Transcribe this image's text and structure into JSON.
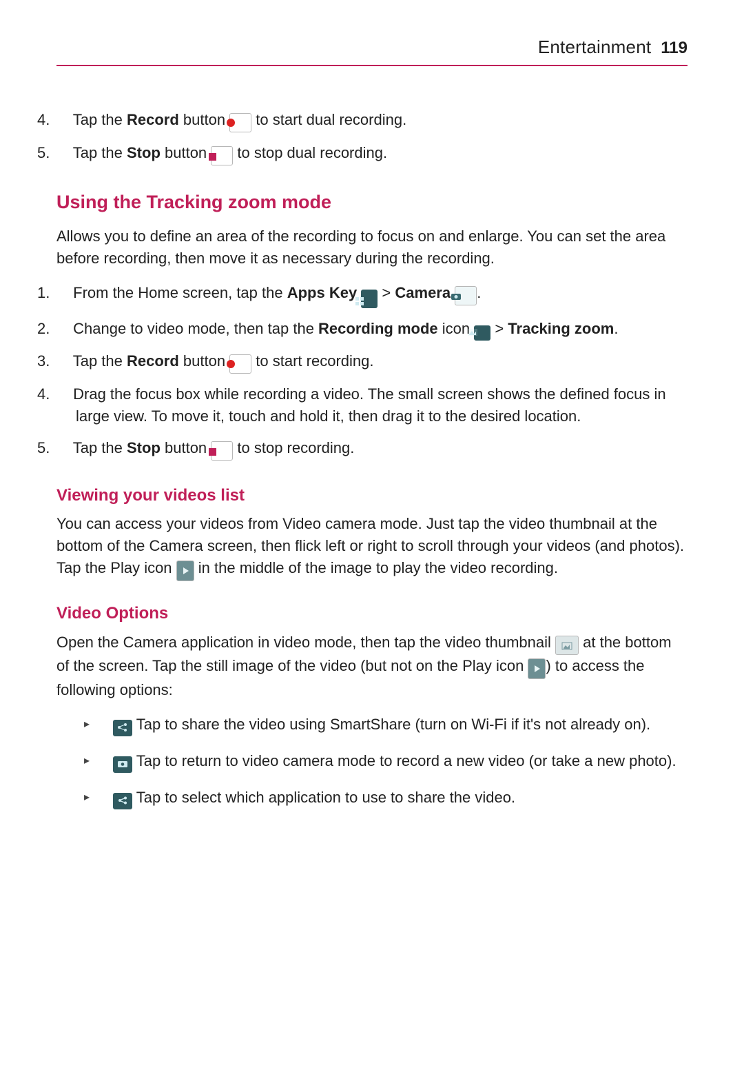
{
  "header": {
    "section": "Entertainment",
    "page_number": "119"
  },
  "intro_steps": [
    {
      "num": "4.",
      "pre": "Tap the ",
      "bold1": "Record",
      "mid1": " button ",
      "icon": "record",
      "post": " to start dual recording."
    },
    {
      "num": "5.",
      "pre": "Tap the ",
      "bold1": "Stop",
      "mid1": " button ",
      "icon": "stop",
      "post": " to stop dual recording."
    }
  ],
  "tracking": {
    "heading": "Using the Tracking zoom mode",
    "intro": "Allows you to define an area of the recording to focus on and enlarge. You can set the area before recording, then move it as necessary during the recording.",
    "step1": {
      "num": "1.",
      "a": "From the Home screen, tap the ",
      "b": "Apps Key",
      "apps_icon": "apps",
      "c": " > ",
      "d": "Camera",
      "camera_icon": "camera",
      "e": "."
    },
    "step2": {
      "num": "2.",
      "a": "Change to video mode, then tap the ",
      "b": "Recording mode",
      "c": " icon ",
      "recmode_icon": "recmode",
      "d": " > ",
      "e": "Tracking zoom",
      "f": "."
    },
    "step3": {
      "num": "3.",
      "a": "Tap the ",
      "b": "Record",
      "c": " button ",
      "record_icon": "record",
      "d": " to start recording."
    },
    "step4": {
      "num": "4.",
      "text": "Drag the focus box while recording a video. The small screen shows the defined focus in large view. To move it, touch and hold it, then drag it to the desired location."
    },
    "step5": {
      "num": "5.",
      "a": "Tap the ",
      "b": "Stop",
      "c": " button ",
      "stop_icon": "stop",
      "d": " to stop recording."
    }
  },
  "viewing": {
    "heading": "Viewing your videos list",
    "a": "You can access your videos from Video camera mode. Just tap the video thumbnail at the bottom of the Camera screen, then flick left or right to scroll through your videos (and photos). Tap the Play icon ",
    "play_icon": "play",
    "b": " in the middle of the image to play the video recording."
  },
  "video_options": {
    "heading": "Video Options",
    "a": "Open the Camera application in video mode, then tap the video thumbnail ",
    "thumb_icon": "thumb",
    "b": " at the bottom of the screen. Tap the still image of the video (but not on the Play icon ",
    "play_icon": "play",
    "c": ") to access the following options:",
    "bullets": [
      {
        "icon": "smartshare",
        "text": " Tap to share the video using SmartShare (turn on Wi-Fi if it's not already on)."
      },
      {
        "icon": "camera-dark",
        "text": " Tap to return to video camera mode to record a new video (or take a new photo)."
      },
      {
        "icon": "share",
        "text": " Tap to select which application to use to share the video."
      }
    ]
  }
}
